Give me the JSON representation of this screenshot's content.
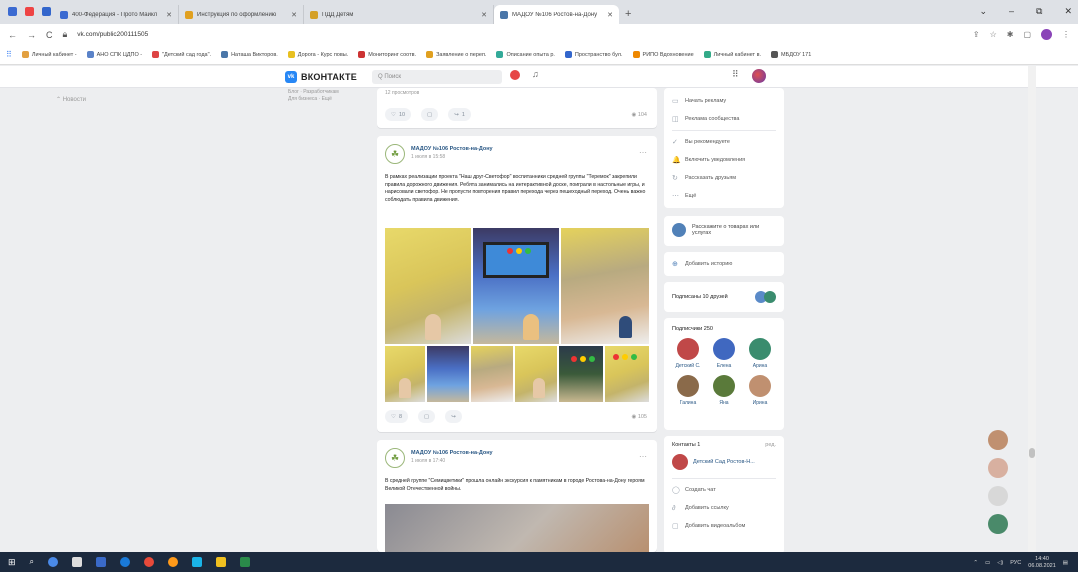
{
  "browser": {
    "tabs": [
      {
        "label": "400-Федерация - Прото Майкл",
        "color": "#3b6ad1",
        "active": false
      },
      {
        "label": "Инструкция по оформлению",
        "color": "#e0a020",
        "active": false
      },
      {
        "label": "ПДД Детям",
        "color": "#d4a028",
        "active": false
      },
      {
        "label": "МАДОУ №106 Ростов-на-Дону",
        "color": "#4a76a8",
        "active": true
      }
    ],
    "new_tab": "+",
    "window_controls": [
      "⌄",
      "–",
      "⧉",
      "✕"
    ],
    "nav": {
      "back": "←",
      "forward": "→",
      "reload": "C"
    },
    "url": "vk.com/public200111505",
    "bookmarks": [
      {
        "label": "Личный кабинет -",
        "color": "#e2a040"
      },
      {
        "label": "АНО СПК ЦДПО -",
        "color": "#5a82c8"
      },
      {
        "label": "\"Детский сад года\".",
        "color": "#d44"
      },
      {
        "label": "Наташа Викторов.",
        "color": "#4a76a8"
      },
      {
        "label": "Дорога - Курс повы.",
        "color": "#e8c020"
      },
      {
        "label": "Мониторинг соотв.",
        "color": "#c33"
      },
      {
        "label": "Заявление о переп.",
        "color": "#e0a020"
      },
      {
        "label": "Описание опыта р.",
        "color": "#3a9"
      },
      {
        "label": "Пространство бул.",
        "color": "#36c"
      },
      {
        "label": "РИПО Вдохновение",
        "color": "#e80"
      },
      {
        "label": "Личный кабинет в.",
        "color": "#3a8"
      },
      {
        "label": "МБДОУ 171",
        "color": "#555"
      }
    ]
  },
  "vk": {
    "logo_text": "ВКОНТАКТЕ",
    "search_placeholder": "Q Поиск",
    "left_nav": "Новости",
    "left_mini": [
      "Блог · Разработчикам",
      "Для бизнеса · Ещё"
    ]
  },
  "posts": [
    {
      "subtitle": "12 просмотров",
      "likes": "10",
      "comments": "",
      "shares": "1",
      "views": "104"
    },
    {
      "author": "МАДОУ №106 Ростов-на-Дону",
      "date": "1 июля в 15:58",
      "text": "В рамках реализации проекта \"Наш друг-Светофор\" воспитанники средней группы \"Теремок\" закрепили правила дорожного движения. Ребята занимались на интерактивной доске, поиграли в настольные игры, и нарисовали светофор. Не пропусти повторения правил перехода через пешеходный переход. Очень важно соблюдать правила движения.",
      "likes": "8",
      "views": "105"
    },
    {
      "author": "МАДОУ №106 Ростов-на-Дону",
      "date": "1 июля в 17:40",
      "text": "В средней группе \"Семицветики\" прошла онлайн экскурсия к памятникам в городе Ростова-на-Дону героям Великой Отечественной войны."
    }
  ],
  "right_menu": [
    {
      "label": "Начать рекламу",
      "icon": "▭"
    },
    {
      "label": "Реклама сообщества",
      "icon": "◫"
    },
    {
      "label": "Вы рекомендуете",
      "icon": "✓"
    },
    {
      "label": "Включить уведомления",
      "icon": "🔔"
    },
    {
      "label": "Рассказать друзьям",
      "icon": "↻"
    },
    {
      "label": "Ещё",
      "icon": "⋯"
    }
  ],
  "right_boxes": {
    "recommend": "Расскажите о товарах или услугах",
    "add_story": "Добавить историю",
    "friends_subscribed": "Подписаны 10 друзей",
    "subscribers_title": "Подписчики  250",
    "subscribers": [
      {
        "name": "Детский С.",
        "color": "#c04848"
      },
      {
        "name": "Елена",
        "color": "#4068c0"
      },
      {
        "name": "Арина",
        "color": "#3a8c6e"
      },
      {
        "name": "Галина",
        "color": "#8a6a4a"
      },
      {
        "name": "Яна",
        "color": "#5a7a3a"
      },
      {
        "name": "Ирина",
        "color": "#c09070"
      }
    ],
    "contacts_title": "Контакты  1",
    "contacts_action": "ред.",
    "contact_name": "Детский Сад Ростов-Н...",
    "actions": [
      "Создать чат",
      "Добавить ссылку",
      "Добавить видеоальбом"
    ]
  },
  "taskbar": {
    "icons": [
      "#4a8ae8",
      "#ddd",
      "#3a6ac8",
      "#1a7ad8",
      "#e84a3a",
      "#ff9a1a",
      "#1ab4e8",
      "#f0c020",
      "#2a8a4a"
    ],
    "lang": "РУС",
    "time": "14:40",
    "date": "06.08.2021"
  }
}
